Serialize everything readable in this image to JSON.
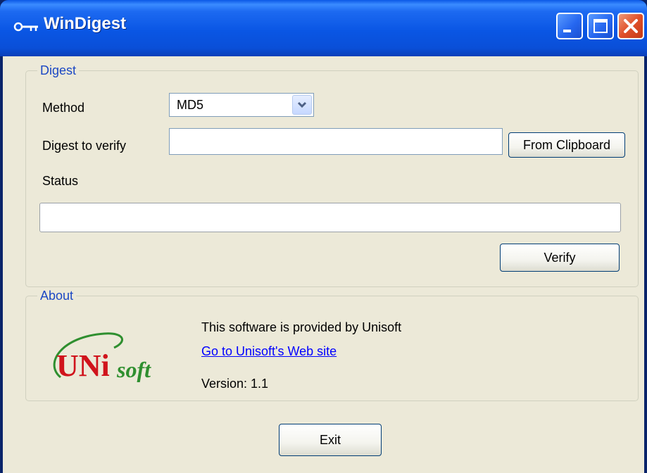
{
  "window": {
    "title": "WinDigest",
    "title_icon": "key-icon",
    "controls": [
      "minimize-icon",
      "maximize-icon",
      "close-icon"
    ]
  },
  "digest_group": {
    "legend": "Digest",
    "method_label": "Method",
    "method_value": "MD5",
    "digest_label": "Digest to verify",
    "digest_value": "",
    "from_clipboard_label": "From Clipboard",
    "status_label": "Status",
    "status_value": "",
    "verify_label": "Verify"
  },
  "about_group": {
    "legend": "About",
    "logo_text_main": "UNi",
    "logo_text_sub": "soft",
    "provided_by": "This software is provided by Unisoft",
    "website_link": "Go to Unisoft's Web site",
    "version": "Version: 1.1"
  },
  "footer": {
    "exit_label": "Exit"
  },
  "colors": {
    "titlebar": "#0a56e4",
    "client_bg": "#ece9d8",
    "legend": "#1c48c4",
    "link": "#0000ff",
    "logo_red": "#d0141c",
    "logo_green": "#2f8f2f"
  }
}
